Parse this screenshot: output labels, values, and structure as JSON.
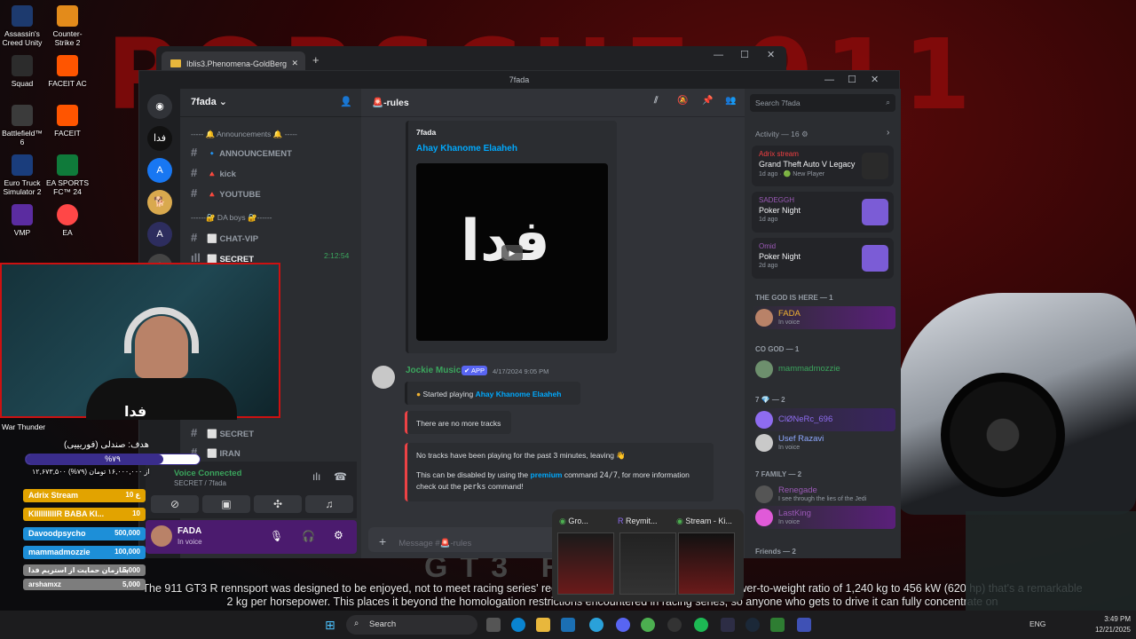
{
  "wallpaper": {
    "title": "PORSCHE 911",
    "model_text": "GT3 R",
    "caption": "The 911 GT3 R rennsport was designed to be enjoyed, not to meet racing series' regulations... exceptionally low target power-to-weight ratio of 1,240 kg to 456 kW (620 hp) that's a remarkable 2 kg per horsepower. This places it beyond the homologation restrictions encountered in racing series, so anyone who gets to drive it can fully concentrate on"
  },
  "desktop_icons": [
    {
      "label": "Assassin's Creed Unity",
      "color": "#1d3a6e"
    },
    {
      "label": "Counter-Strike 2",
      "color": "#e38b1b"
    },
    {
      "label": "Squad",
      "color": "#2c2c2c"
    },
    {
      "label": "FACEIT AC",
      "color": "#ff5500"
    },
    {
      "label": "Battlefield™ 6",
      "color": "#3b3b3b"
    },
    {
      "label": "FACEIT",
      "color": "#ff5500"
    },
    {
      "label": "Euro Truck Simulator 2",
      "color": "#1a3d7c"
    },
    {
      "label": "EA SPORTS FC™ 24",
      "color": "#0f7a3a"
    },
    {
      "label": "VMP",
      "color": "#5b2ca0"
    },
    {
      "label": "EA",
      "color": "#ff4747"
    }
  ],
  "browser": {
    "tab_title": "Iblis3.Phenomena-GoldBerg",
    "new_tab": "+",
    "controls": [
      "—",
      "☐",
      "✕"
    ]
  },
  "discord": {
    "window_title": "7fada",
    "server_name": "7fada",
    "categories": [
      {
        "label": "----- 🔔 Announcements 🔔 -----"
      },
      {
        "label": "------🔐 DA boys 🔐------"
      }
    ],
    "channels": [
      {
        "label": "🔹 ANNOUNCEMENT"
      },
      {
        "label": "🔺 kick"
      },
      {
        "label": "🔺 YOUTUBE"
      },
      {
        "label": "⬜ CHAT-VIP"
      },
      {
        "label": "⬜ SECRET",
        "timer": "2:12:54"
      },
      {
        "label": "⬜ SECRET"
      },
      {
        "label": "⬜ IRAN"
      }
    ],
    "voice": {
      "status": "Voice Connected",
      "channel": "SECRET / 7fada"
    },
    "user": {
      "name": "FADA",
      "status": "In voice"
    },
    "channel_header": "🚨-rules",
    "embed": {
      "author": "7fada",
      "title": "Ahay Khanome Elaaheh",
      "image_text": "فدا"
    },
    "message": {
      "author": "Jockie Music",
      "tag": "✔ APP",
      "timestamp": "4/17/2024 9:05 PM",
      "now_playing_prefix": "Started playing",
      "now_playing_track": "Ahay Khanome Elaaheh",
      "no_more": "There are no more tracks",
      "leaving": "No tracks have been playing for the past 3 minutes, leaving 👋",
      "premium_line_1": "This can be disabled by using the",
      "premium_word": "premium",
      "premium_line_2": "command",
      "cmd1": "24/7",
      "premium_line_3": ", for more information check out the",
      "cmd2": "perks",
      "premium_line_4": "command!"
    },
    "input_placeholder": "Message #🚨-rules",
    "search_placeholder": "Search 7fada",
    "activity_header": "Activity — 16 ⚙",
    "activities": [
      {
        "who": "Adrix stream",
        "who_color": "#f23f42",
        "what": "Grand Theft Auto V Legacy",
        "when": "1d ago · 🟢 New Player",
        "art": "#2a2a2a"
      },
      {
        "who": "SADEGGH",
        "who_color": "#9b59b6",
        "what": "Poker Night",
        "when": "1d ago",
        "art": "#7b5cd6"
      },
      {
        "who": "Omid",
        "who_color": "#9b59b6",
        "what": "Poker Night",
        "when": "2d ago",
        "art": "#7b5cd6"
      }
    ],
    "groups": [
      {
        "label": "THE GOD IS HERE — 1",
        "members": [
          {
            "name": "FADA",
            "color": "#f0b232",
            "sub": "In voice",
            "bg": "#5a1f7a"
          }
        ]
      },
      {
        "label": "CO GOD — 1",
        "members": [
          {
            "name": "mammadmozzie",
            "color": "#3ba55d",
            "sub": "",
            "bg": ""
          }
        ]
      },
      {
        "label": "7 💎 — 2",
        "members": [
          {
            "name": "ClØNeRc_696",
            "color": "#8e6cf0",
            "sub": "",
            "bg": "#3a2460"
          },
          {
            "name": "Usef Razavi",
            "color": "#8ea8ff",
            "sub": "In voice",
            "bg": ""
          }
        ]
      },
      {
        "label": "7 FAMILY — 2",
        "members": [
          {
            "name": "Renegade",
            "color": "#9b59b6",
            "sub": "I see through the lies of the Jedi",
            "bg": ""
          },
          {
            "name": "LastKing",
            "color": "#9b59b6",
            "sub": "In voice",
            "bg": "#5a1f7a"
          }
        ]
      },
      {
        "label": "Friends — 2",
        "members": []
      }
    ]
  },
  "stream_overlay": {
    "goal": "هدف: صندلی (فوریییی)",
    "progress_text": "%۷۹",
    "progress": 0.79,
    "money": "۱۲,۶۷۳,۵۰۰ از ۱۶,۰۰۰,۰۰۰ تومان (۷۹%)",
    "name_tag": "فدا",
    "war_thunder": "War Thunder",
    "leaderboard": [
      {
        "name": "Adrix Stream",
        "value": "10 ع",
        "color": "#e2a300"
      },
      {
        "name": "KIIIIIIIIIIR BABA KI...",
        "value": "10",
        "color": "#e2a300"
      },
      {
        "name": "Davoodpsycho",
        "value": "500,000",
        "color": "#1d8fd8"
      },
      {
        "name": "mammadmozzie",
        "value": "100,000",
        "color": "#1d8fd8"
      },
      {
        "name": "سازمان حمایت از استریم فدا",
        "value": "5,000",
        "color": "#7d7d7d"
      },
      {
        "name": "arshamxz",
        "value": "5,000",
        "color": "#7d7d7d"
      }
    ]
  },
  "taskbar_preview": [
    {
      "label": "Gro..."
    },
    {
      "label": "Reymit..."
    },
    {
      "label": "Stream - Ki..."
    }
  ],
  "taskbar": {
    "search": "Search",
    "lang": "ENG",
    "time": "3:49 PM",
    "date": "12/21/2025"
  }
}
